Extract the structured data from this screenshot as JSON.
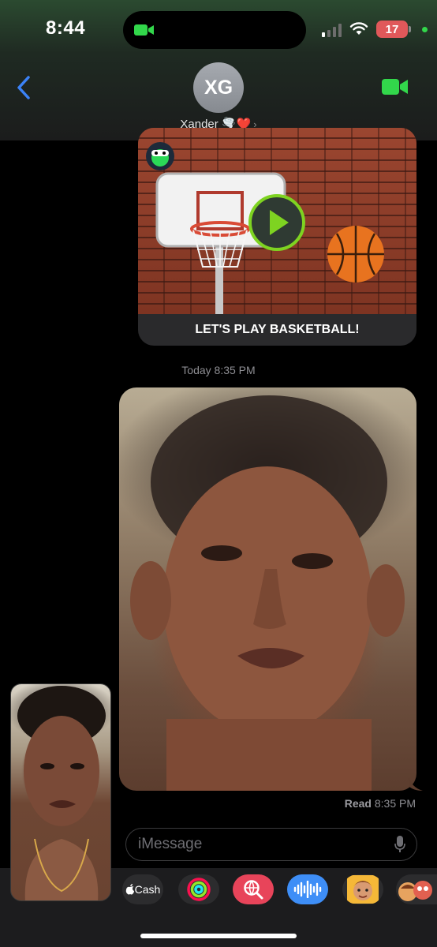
{
  "status_bar": {
    "time": "8:44",
    "battery": "17",
    "icons": [
      "facetime-camera-icon",
      "cellular-signal-icon",
      "wifi-icon",
      "battery-icon"
    ]
  },
  "header": {
    "avatar_initials": "XG",
    "contact_name": "Xander 🌪️❤️",
    "contact_chevron": "›",
    "colors": {
      "accent": "#3b82f6",
      "facetime": "#32d74b"
    }
  },
  "thread": {
    "game_card": {
      "caption": "LET'S PLAY BASKETBALL!"
    },
    "timestamp": "Today 8:35 PM",
    "read_receipt": {
      "label": "Read",
      "time": "8:35 PM"
    }
  },
  "composer": {
    "placeholder": "iMessage"
  },
  "app_drawer": {
    "cash_label": "Cash",
    "apps": [
      "apple-cash",
      "fitness",
      "image-search",
      "audio-message",
      "memoji",
      "memoji-stickers"
    ]
  }
}
